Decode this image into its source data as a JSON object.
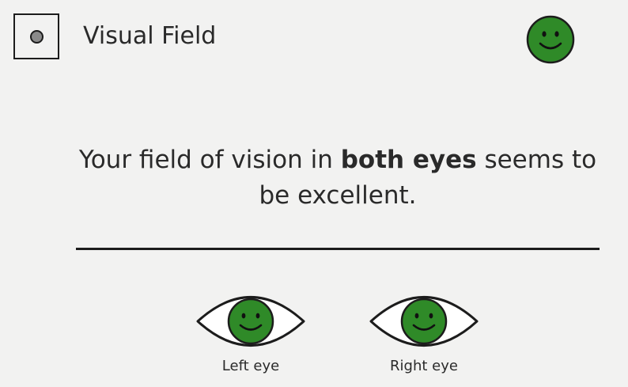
{
  "header": {
    "title": "Visual Field",
    "status_icon": "green-smiley-icon",
    "checkbox_icon": "gray-dot-icon"
  },
  "result": {
    "message_before": "Your field of vision in ",
    "message_emphasis": "both eyes",
    "message_after": " seems to be excellent."
  },
  "eyes": {
    "left": {
      "label": "Left eye",
      "icon": "green-smiley-eye-icon"
    },
    "right": {
      "label": "Right eye",
      "icon": "green-smiley-eye-icon"
    }
  },
  "colors": {
    "background": "#f2f2f1",
    "smiley_green": "#2f8a28",
    "outline": "#1c1c1c",
    "dot_gray": "#8a8a8a"
  }
}
